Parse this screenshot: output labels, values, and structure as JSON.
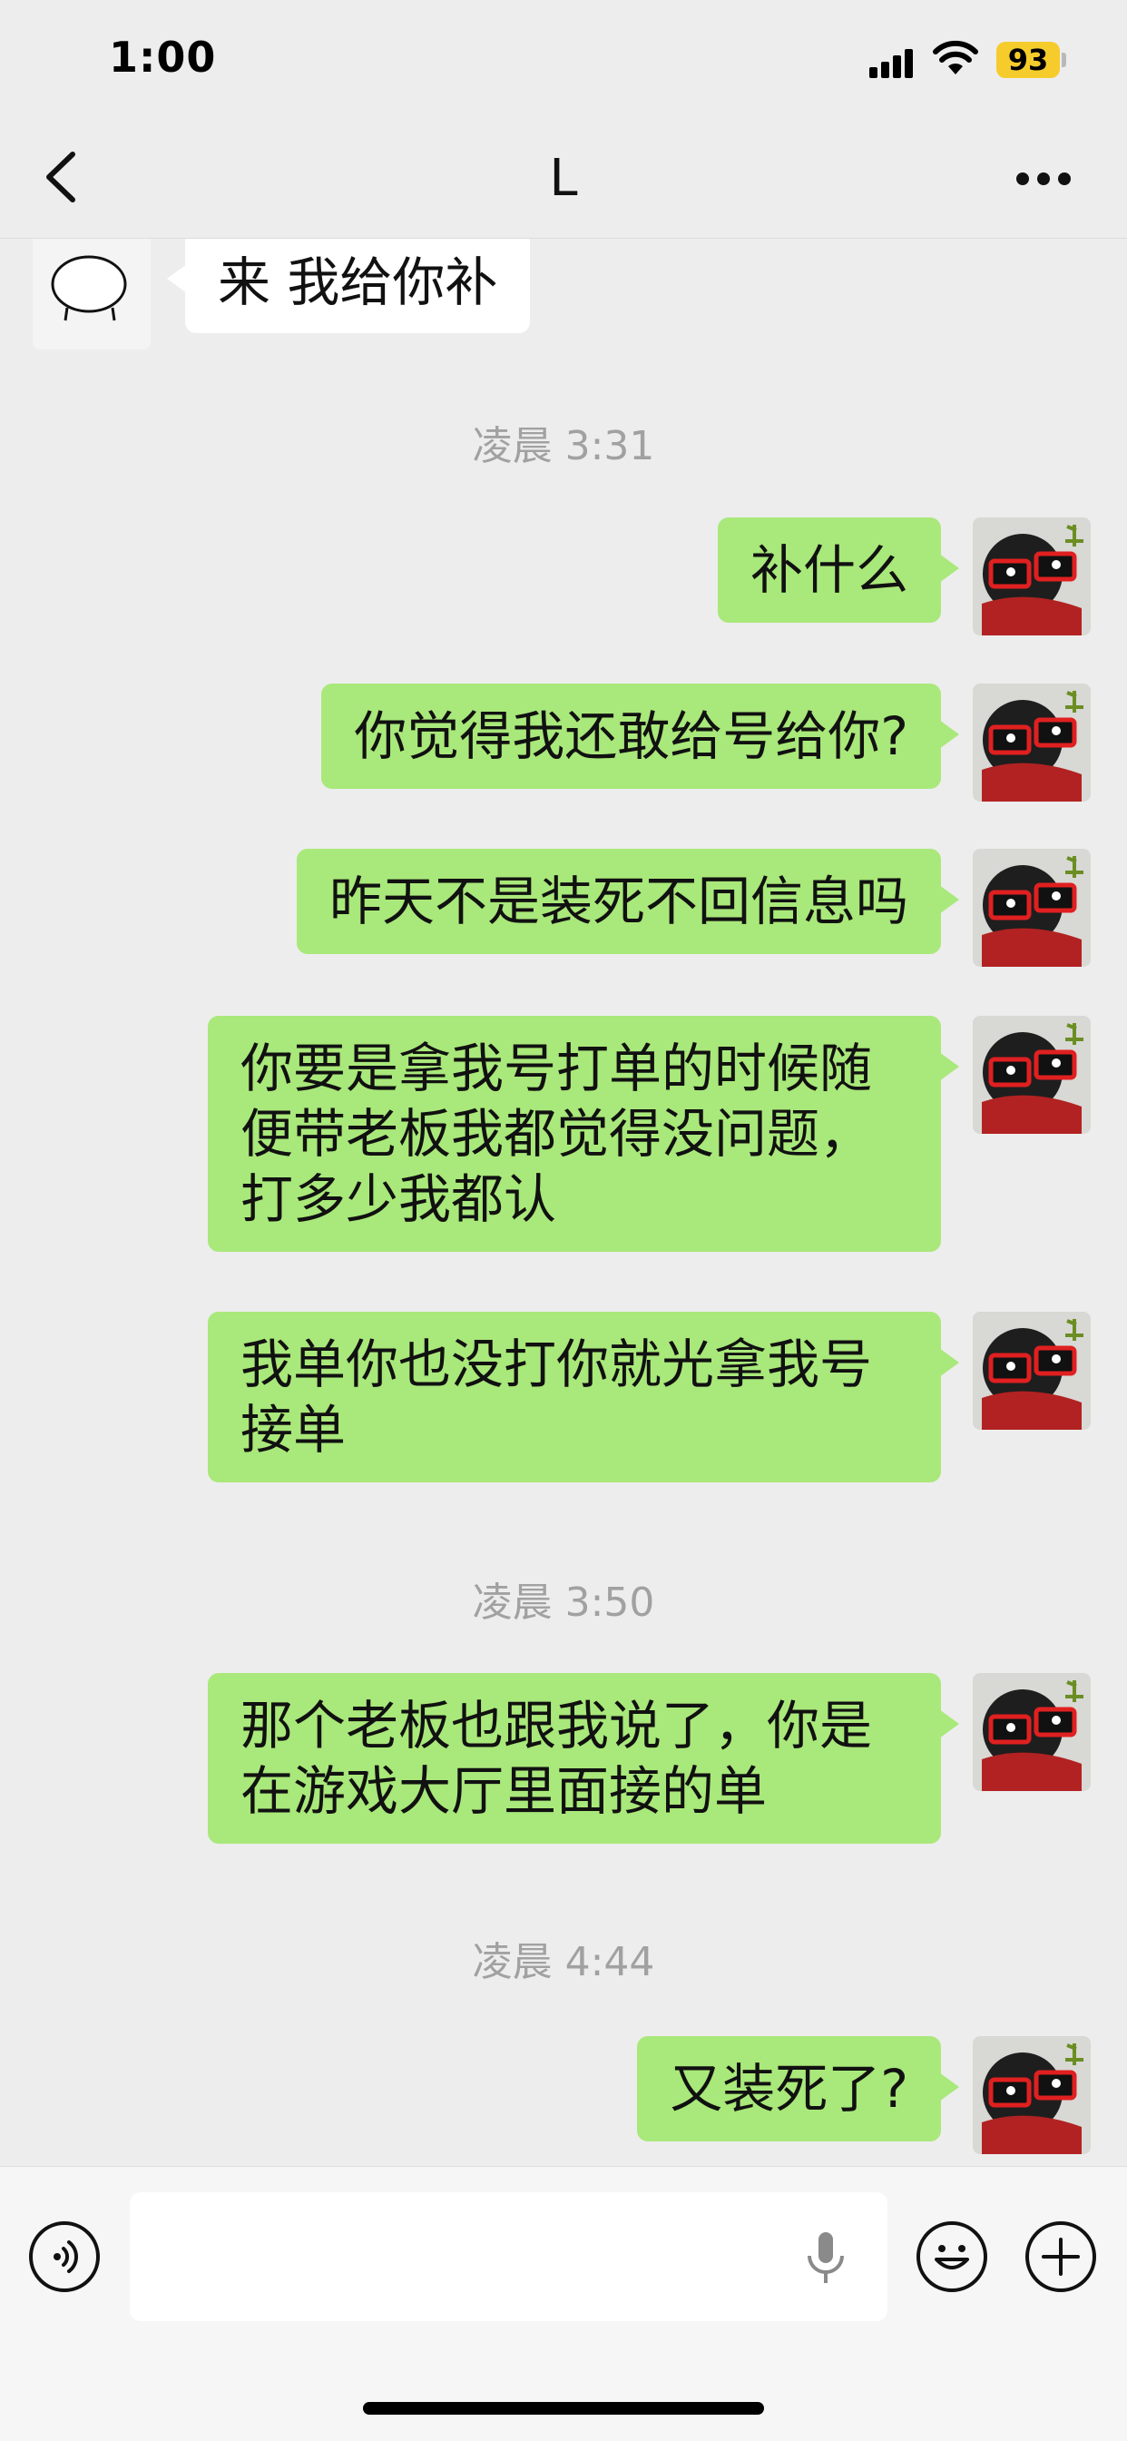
{
  "status": {
    "time": "1:00",
    "battery": "93"
  },
  "nav": {
    "title": "L"
  },
  "chat": {
    "incoming": [
      {
        "text": "来 我给你补"
      }
    ],
    "timestamps": [
      "凌晨 3:31",
      "凌晨 3:50",
      "凌晨 4:44"
    ],
    "outgoing": [
      {
        "text": "补什么"
      },
      {
        "text": "你觉得我还敢给号给你?"
      },
      {
        "text": "昨天不是装死不回信息吗"
      },
      {
        "text": "你要是拿我号打单的时候随便带老板我都觉得没问题，打多少我都认"
      },
      {
        "text": "我单你也没打你就光拿我号接单"
      },
      {
        "text": "那个老板也跟我说了，你是在游戏大厅里面接的单"
      },
      {
        "text": "又装死了?"
      }
    ]
  },
  "input": {
    "value": ""
  },
  "colors": {
    "bubble_out": "#a9e87a",
    "bubble_in": "#ffffff",
    "background": "#ededed",
    "battery": "#f5cc2c"
  },
  "icons": [
    "back-chevron-icon",
    "more-icon",
    "voice-icon",
    "mic-icon",
    "emoji-icon",
    "plus-icon"
  ]
}
